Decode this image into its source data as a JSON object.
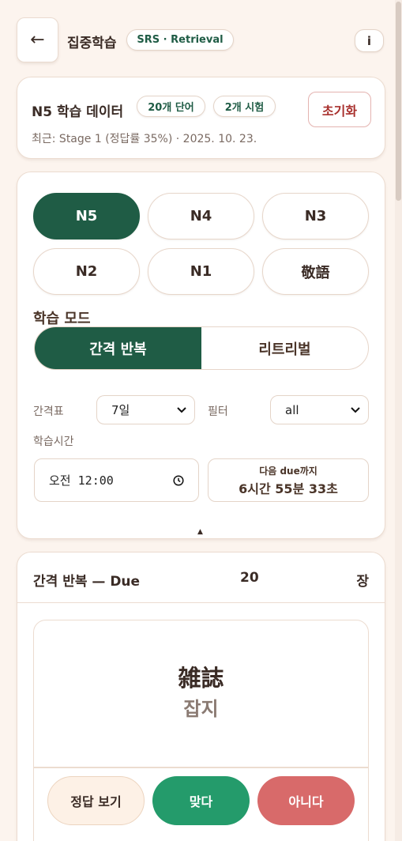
{
  "header": {
    "back_icon": "←",
    "title": "집중학습",
    "badge": "SRS · Retrieval",
    "info_label": "i"
  },
  "data_card": {
    "title": "N5 학습 데이터",
    "words_chip": "20개 단어",
    "tests_chip": "2개 시험",
    "reset_label": "초기화",
    "recent": "최근: Stage 1 (정답률 35%) · 2025. 10. 23."
  },
  "settings": {
    "levels": [
      "N5",
      "N4",
      "N3",
      "N2",
      "N1",
      "敬語"
    ],
    "active_level": "N5",
    "mode_label": "학습 모드",
    "modes": [
      "간격 반복",
      "리트리벌"
    ],
    "active_mode": "간격 반복",
    "interval_label": "간격표",
    "interval_value": "7일",
    "filter_label": "필터",
    "filter_value": "all",
    "study_time_label": "학습시간",
    "study_time_value": "오전 12:00",
    "next_due_label": "다음 due까지",
    "next_due_value": "6시간 55분 33초",
    "collapse_icon": "▲"
  },
  "study": {
    "title": "간격 반복 — Due",
    "count": "20",
    "unit": "장",
    "word": "雑誌",
    "reading": "잡지",
    "show_answer": "정답 보기",
    "correct": "맞다",
    "wrong": "아니다"
  },
  "colors": {
    "accent": "#1f5c45",
    "correct": "#249b6b",
    "wrong": "#d86a6a",
    "reset": "#a8302d",
    "background": "#fcf4ee"
  }
}
